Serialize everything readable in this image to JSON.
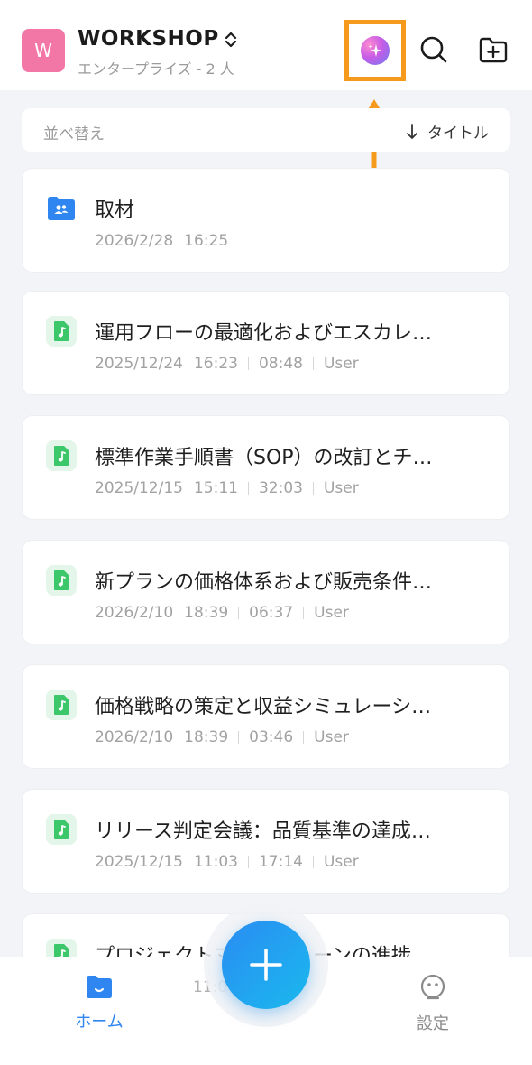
{
  "header": {
    "workspace_initial": "W",
    "workspace_name": "WORKSHOP",
    "workspace_subtitle": "エンタープライズ - 2 人",
    "ai_icon": "ai-sparkle-icon",
    "search_icon": "search-icon",
    "new_folder_icon": "new-folder-icon"
  },
  "sort": {
    "label": "並べ替え",
    "field": "タイトル",
    "direction_icon": "arrow-down-icon"
  },
  "items": [
    {
      "type": "folder",
      "title": "取材",
      "date": "2026/2/28",
      "time": "16:25",
      "duration": "",
      "owner": ""
    },
    {
      "type": "audio",
      "title": "運用フローの最適化およびエスカレ…",
      "date": "2025/12/24",
      "time": "16:23",
      "duration": "08:48",
      "owner": "User"
    },
    {
      "type": "audio",
      "title": "標準作業手順書（SOP）の改訂とチ…",
      "date": "2025/12/15",
      "time": "15:11",
      "duration": "32:03",
      "owner": "User"
    },
    {
      "type": "audio",
      "title": "新プランの価格体系および販売条件…",
      "date": "2026/2/10",
      "time": "18:39",
      "duration": "06:37",
      "owner": "User"
    },
    {
      "type": "audio",
      "title": "価格戦略の策定と収益シミュレーシ…",
      "date": "2026/2/10",
      "time": "18:39",
      "duration": "03:46",
      "owner": "User"
    },
    {
      "type": "audio",
      "title": "リリース判定会議：品質基準の達成…",
      "date": "2025/12/15",
      "time": "11:03",
      "duration": "17:14",
      "owner": "User"
    },
    {
      "type": "audio",
      "title": "プロジェクトマイルストーンの進捗",
      "date": "",
      "time": "",
      "duration": "",
      "owner": ""
    }
  ],
  "bottom_nav": {
    "home_label": "ホーム",
    "settings_label": "設定",
    "bleed_text": "11:0",
    "fab_icon": "plus-icon"
  },
  "colors": {
    "accent_blue": "#2f86f0",
    "highlight_orange": "#f59a1d",
    "workspace_pink": "#f276a6",
    "audio_green": "#3cc76a"
  }
}
